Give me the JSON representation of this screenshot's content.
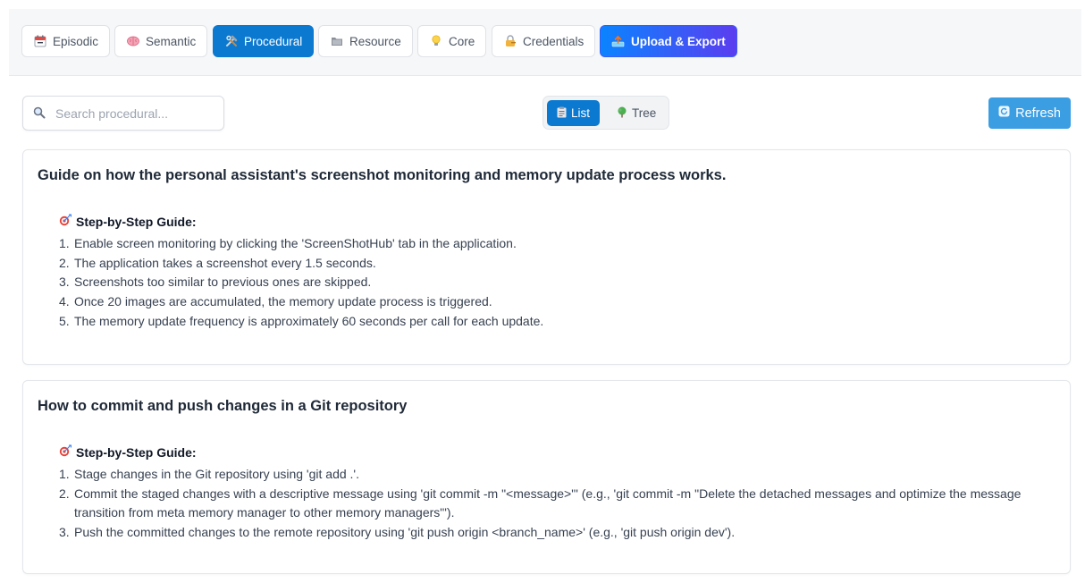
{
  "tabs": [
    {
      "label": "Episodic",
      "icon": "calendar-icon",
      "active": false
    },
    {
      "label": "Semantic",
      "icon": "brain-icon",
      "active": false
    },
    {
      "label": "Procedural",
      "icon": "tools-icon",
      "active": true
    },
    {
      "label": "Resource",
      "icon": "folder-icon",
      "active": false
    },
    {
      "label": "Core",
      "icon": "lightbulb-icon",
      "active": false
    },
    {
      "label": "Credentials",
      "icon": "lock-icon",
      "active": false
    },
    {
      "label": "Upload & Export",
      "icon": "upload-tray-icon",
      "active": false
    }
  ],
  "search": {
    "placeholder": "Search procedural...",
    "value": "",
    "icon": "magnifier-icon"
  },
  "view_toggle": {
    "list_label": "List",
    "tree_label": "Tree",
    "active": "list",
    "list_icon": "clipboard-icon",
    "tree_icon": "tree-icon"
  },
  "refresh": {
    "label": "Refresh",
    "icon": "refresh-icon"
  },
  "cards": [
    {
      "title": "Guide on how the personal assistant's screenshot monitoring and memory update process works.",
      "guide_heading": "Step-by-Step Guide:",
      "steps": [
        {
          "num": "1.",
          "text": "Enable screen monitoring by clicking the 'ScreenShotHub' tab in the application."
        },
        {
          "num": "2.",
          "text": "The application takes a screenshot every 1.5 seconds."
        },
        {
          "num": "3.",
          "text": "Screenshots too similar to previous ones are skipped."
        },
        {
          "num": "4.",
          "text": "Once 20 images are accumulated, the memory update process is triggered."
        },
        {
          "num": "5.",
          "text": "The memory update frequency is approximately 60 seconds per call for each update."
        }
      ]
    },
    {
      "title": "How to commit and push changes in a Git repository",
      "guide_heading": "Step-by-Step Guide:",
      "steps": [
        {
          "num": "1.",
          "text": "Stage changes in the Git repository using 'git add .'."
        },
        {
          "num": "2.",
          "text": "Commit the staged changes with a descriptive message using 'git commit -m \"<message>\"' (e.g., 'git commit -m \"Delete the detached messages and optimize the message transition from meta memory manager to other memory managers\"')."
        },
        {
          "num": "3.",
          "text": "Push the committed changes to the remote repository using 'git push origin <branch_name>' (e.g., 'git push origin dev')."
        }
      ]
    }
  ],
  "colors": {
    "active_tab": "#0b79d0",
    "upload_gradient_start": "#0a84ff",
    "upload_gradient_end": "#5b3df0",
    "refresh_button": "#3b9ee3",
    "guide_icon": "#e4433a"
  }
}
